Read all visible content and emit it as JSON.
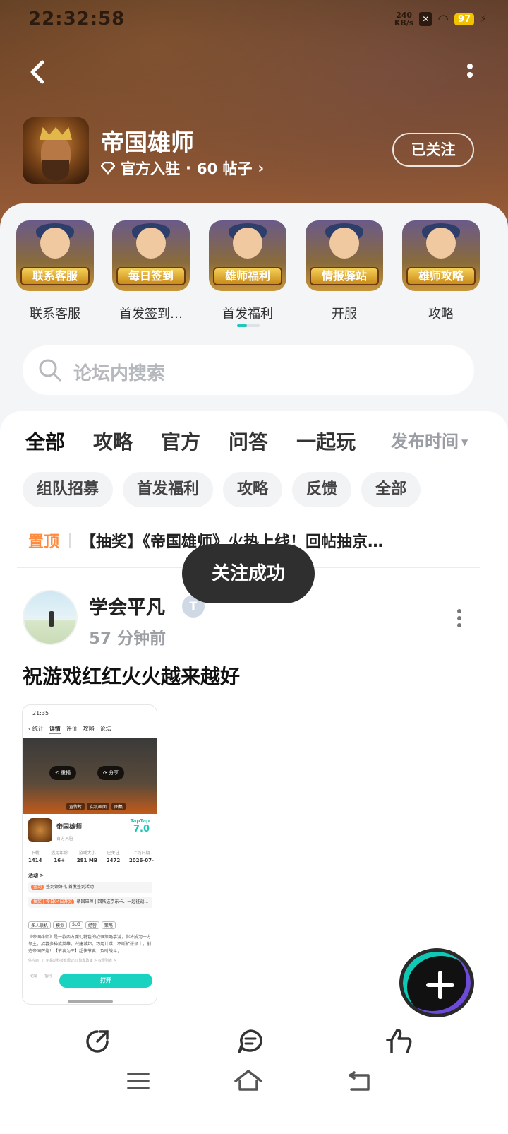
{
  "status_bar": {
    "time": "22:32:58",
    "speed_value": "240",
    "speed_unit": "KB/s",
    "battery": "97"
  },
  "header": {
    "game_title": "帝国雄师",
    "official_label": "官方入驻",
    "dot": "·",
    "posts_label": "60 帖子",
    "follow_button": "已关注"
  },
  "shortcuts": [
    {
      "badge": "联系客服",
      "label": "联系客服"
    },
    {
      "badge": "每日签到",
      "label": "首发签到…"
    },
    {
      "badge": "雄师福利",
      "label": "首发福利"
    },
    {
      "badge": "情报驿站",
      "label": "开服"
    },
    {
      "badge": "雄师攻略",
      "label": "攻略"
    }
  ],
  "search": {
    "placeholder": "论坛内搜索"
  },
  "tabs": [
    "全部",
    "攻略",
    "官方",
    "问答",
    "一起玩"
  ],
  "sort_label": "发布时间",
  "chips": [
    "组队招募",
    "首发福利",
    "攻略",
    "反馈",
    "全部"
  ],
  "pinned": {
    "tag": "置顶",
    "text": "【抽奖】《帝国雄师》火热上线！回帖抽京…"
  },
  "toast": "关注成功",
  "post": {
    "user": "学会平凡",
    "time": "57 分钟前",
    "title": "祝游戏红红火火越来越好"
  },
  "screenshot": {
    "time": "21:35",
    "nav": [
      "统计",
      "详情",
      "评价",
      "攻略",
      "论坛"
    ],
    "replay": "重播",
    "share": "分享",
    "banner_tabs": [
      "宣传片",
      "实机画面",
      "图集"
    ],
    "game_name": "帝国雄师",
    "official": "官方入驻",
    "score_brand": "TapTap",
    "score": "7.0",
    "stats": [
      {
        "label": "下载",
        "value": "1414"
      },
      {
        "label": "适用年龄",
        "value": "16+"
      },
      {
        "label": "游戏大小",
        "value": "281 MB"
      },
      {
        "label": "已关注",
        "value": "2472"
      },
      {
        "label": "上线日期",
        "value": "2026-07-"
      }
    ],
    "activity_label": "活动 >",
    "row1_tag": "签到",
    "row1_text": "签到领好礼 首发签到活动",
    "row2_tag": "抽奖 | 今日04日开奖",
    "row2_text": "帝国雄师 | 回帖送京东卡、一起征战...",
    "tags": [
      "多人联机",
      "模拟",
      "SLG",
      "经营",
      "策略"
    ],
    "description": "《帝国雄师》是一款西方魔幻特色的战争策略手游，你将成为一方领主，招募多种族英雄，兴建城邦，巧用计谋，不断扩张领土，创造帝国辉煌！【节奏为王】超快节奏，及时战斗；",
    "developer": "供应商：广州易动科技有限公司   隐私政策 >   权限列表 >",
    "small_1": "论坛",
    "small_2": "福利",
    "open_button": "打开"
  }
}
